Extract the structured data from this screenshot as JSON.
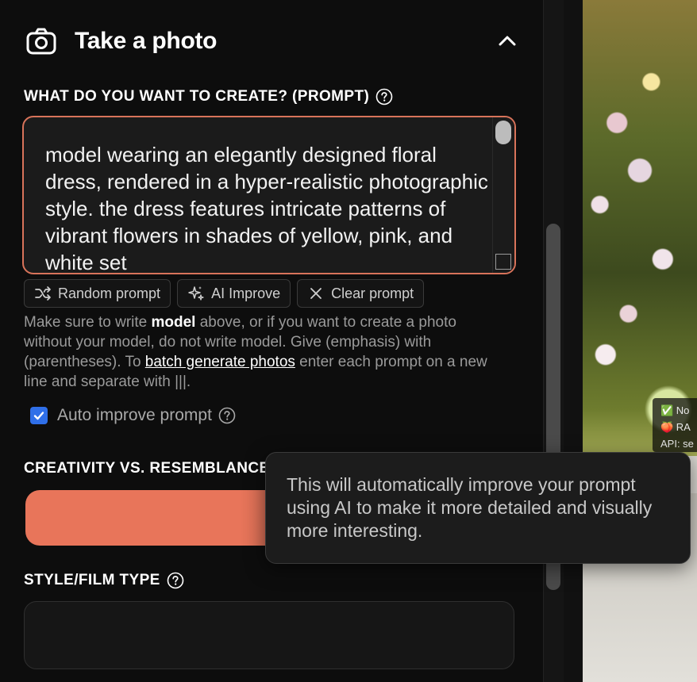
{
  "section": {
    "title": "Take a photo",
    "camera_icon": "camera-icon",
    "collapse_icon": "chevron-up-icon"
  },
  "prompt": {
    "label": "WHAT DO YOU WANT TO CREATE? (PROMPT)",
    "value": "model wearing an elegantly designed floral dress, rendered in a hyper-realistic photographic style. the dress features intricate patterns of vibrant flowers in shades of yellow, pink, and white set",
    "accent_color": "#d8735a"
  },
  "actions": {
    "random_label": "Random prompt",
    "ai_improve_label": "AI Improve",
    "clear_label": "Clear prompt"
  },
  "help": {
    "part1": "Make sure to write ",
    "bold": "model",
    "part2": " above, or if you want to create a photo without your model, do not write model. Give (emphasis) with (parentheses). To ",
    "link": "batch generate photos",
    "part3": " enter each prompt on a new line and separate with |||."
  },
  "auto_improve": {
    "label": "Auto improve prompt",
    "checked": true
  },
  "creativity": {
    "label": "CREATIVITY VS. RESEMBLANCE",
    "slider_color": "#e8755a"
  },
  "style": {
    "label": "STYLE/FILM TYPE",
    "value": ""
  },
  "tooltip": {
    "text": "This will automatically improve your prompt using AI to make it more detailed and visually more interesting."
  },
  "overlay": {
    "line1": "✅ No",
    "line2": "🍑 RA",
    "line3": "API: se"
  }
}
